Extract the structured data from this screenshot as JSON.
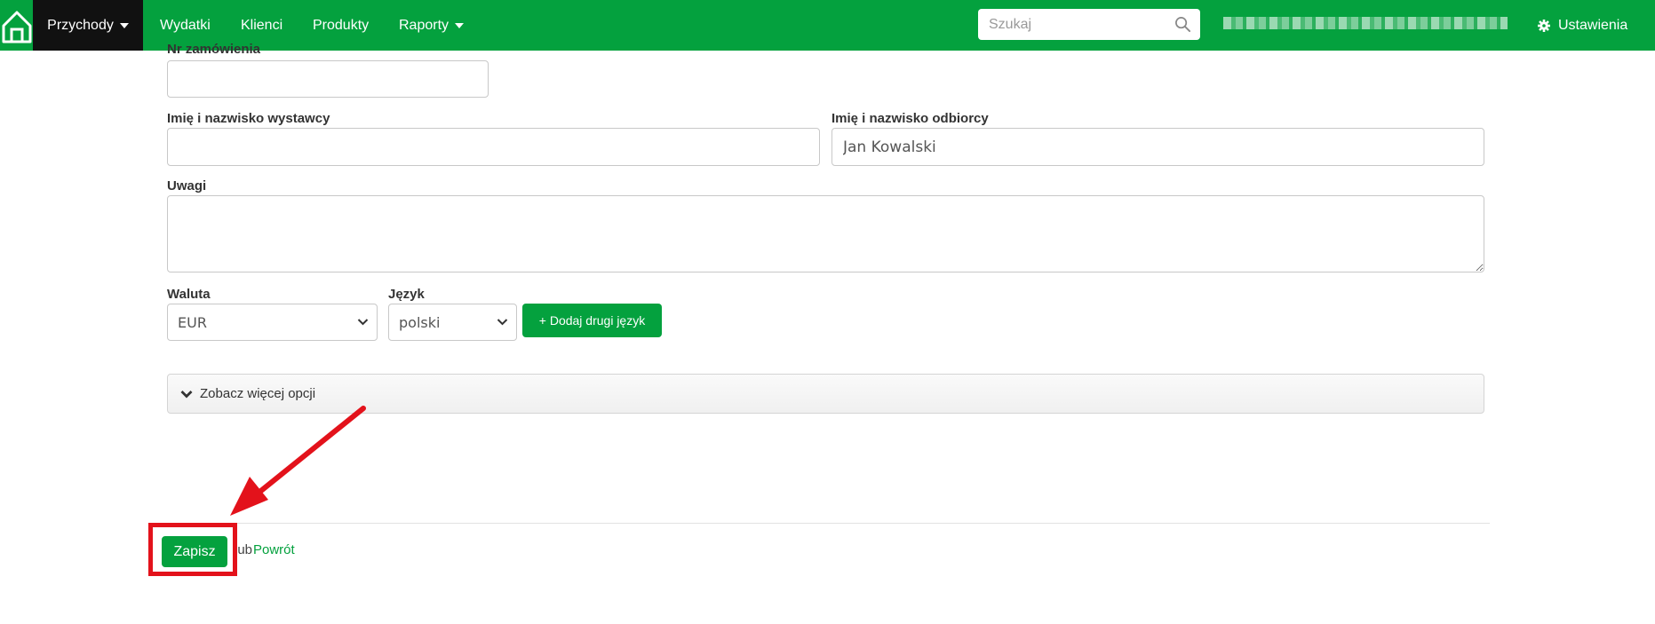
{
  "colors": {
    "brand": "#04a13e",
    "active_nav": "#111111",
    "annotation": "#e3121b"
  },
  "navbar": {
    "home_icon": "home-icon",
    "items": [
      {
        "label": "Przychody",
        "dropdown": true,
        "active": true
      },
      {
        "label": "Wydatki"
      },
      {
        "label": "Klienci"
      },
      {
        "label": "Produkty"
      },
      {
        "label": "Raporty",
        "dropdown": true
      }
    ],
    "search_placeholder": "Szukaj",
    "settings_label": "Ustawienia"
  },
  "form": {
    "order_no": {
      "label": "Nr zamówienia",
      "value": ""
    },
    "issuer": {
      "label": "Imię i nazwisko wystawcy",
      "value": ""
    },
    "recipient": {
      "label": "Imię i nazwisko odbiorcy",
      "value": "Jan Kowalski"
    },
    "notes": {
      "label": "Uwagi",
      "value": ""
    },
    "currency": {
      "label": "Waluta",
      "selected": "EUR"
    },
    "language": {
      "label": "Język",
      "selected": "polski"
    },
    "add_language_button": "+ Dodaj drugi język",
    "more_options": "Zobacz więcej opcji"
  },
  "footer": {
    "save_button": "Zapisz",
    "or_text": "lub",
    "back_link": "Powrót"
  }
}
